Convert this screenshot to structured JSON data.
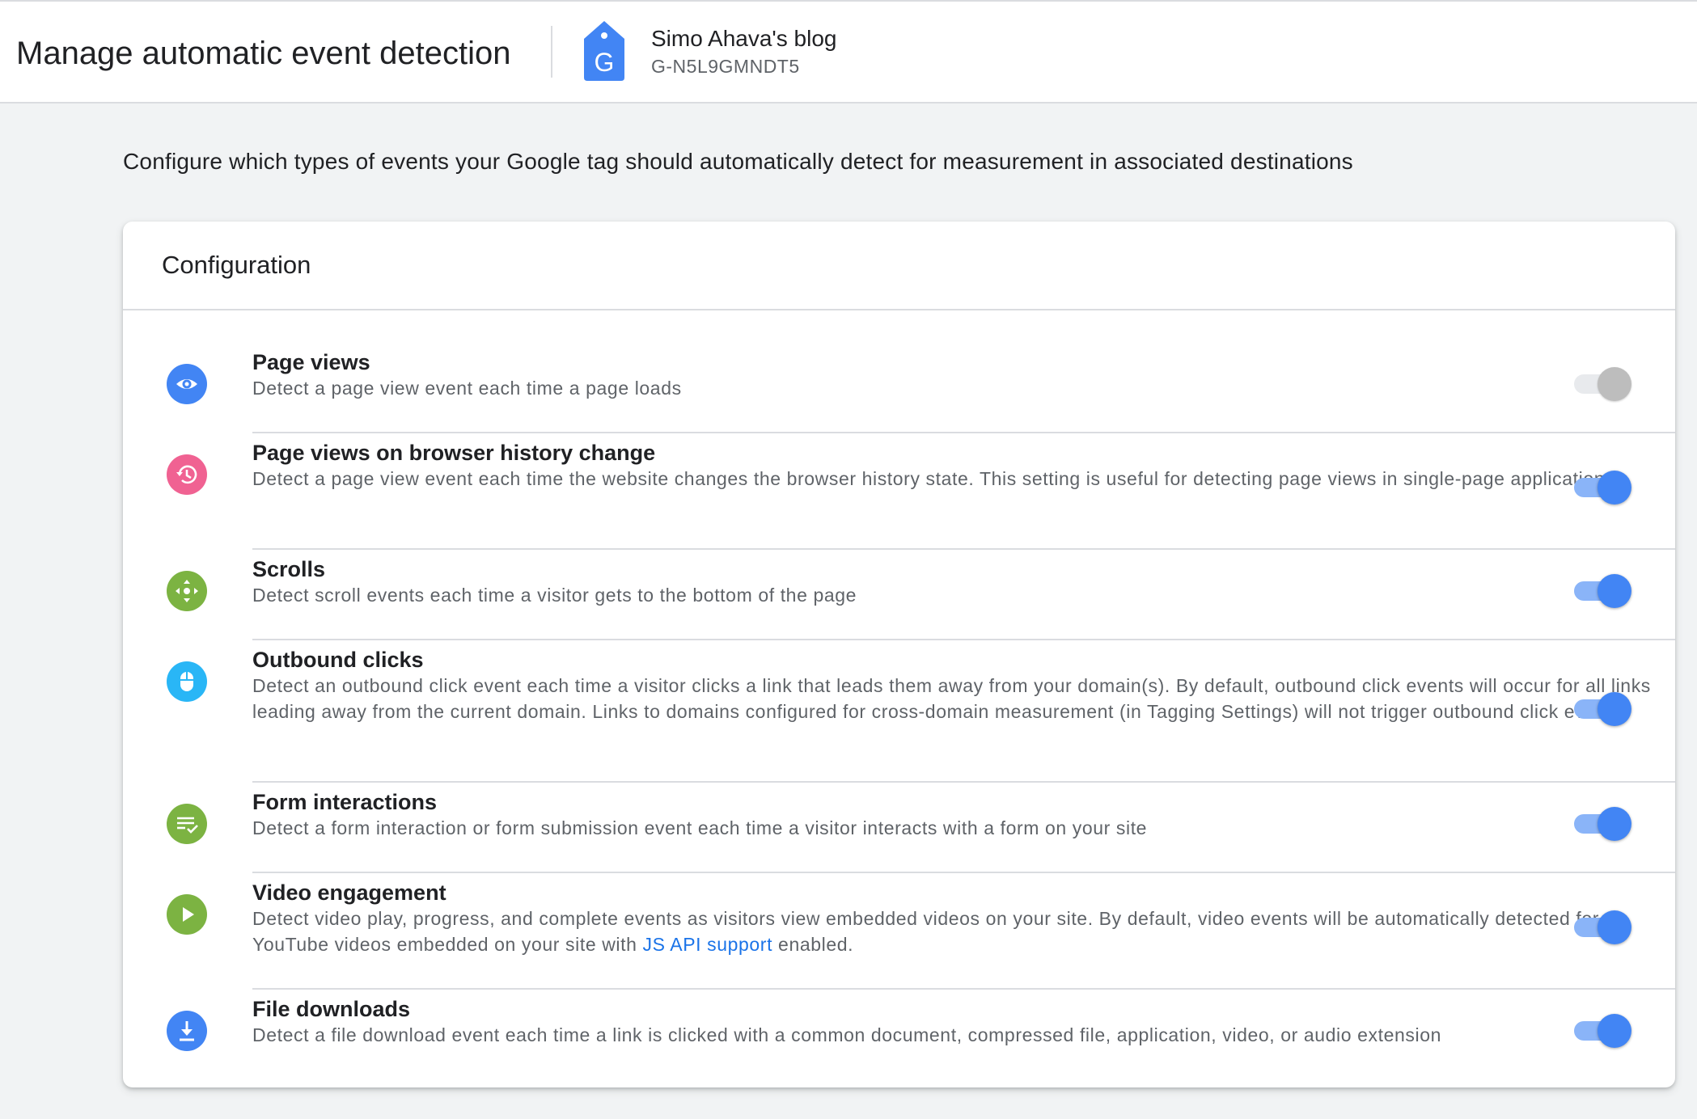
{
  "header": {
    "title": "Manage automatic event detection",
    "property_name": "Simo Ahava's blog",
    "property_id": "G-N5L9GMNDT5",
    "tag_icon": "google-tag-icon",
    "tag_icon_letter": "G"
  },
  "intro": "Configure which types of events your Google tag should automatically detect for measurement in associated destinations",
  "card": {
    "title": "Configuration"
  },
  "settings": [
    {
      "title": "Page views",
      "description": "Detect a page view event each time a page loads",
      "icon": "eye-icon",
      "icon_color": "#4285f4",
      "enabled": true,
      "disabled": true
    },
    {
      "title": "Page views on browser history change",
      "description": "Detect a page view event each time the website changes the browser history state. This setting is useful for detecting page views in single-page applications.",
      "icon": "history-icon",
      "icon_color": "#f06292",
      "enabled": true
    },
    {
      "title": "Scrolls",
      "description": "Detect scroll events each time a visitor gets to the bottom of the page",
      "icon": "move-icon",
      "icon_color": "#7cb342",
      "enabled": true
    },
    {
      "title": "Outbound clicks",
      "description": "Detect an outbound click event each time a visitor clicks a link that leads them away from your domain(s). By default, outbound click events will occur for all links leading away from the current domain. Links to domains configured for cross-domain measurement (in Tagging Settings) will not trigger outbound click events.",
      "icon": "mouse-icon",
      "icon_color": "#29b6f6",
      "enabled": true
    },
    {
      "title": "Form interactions",
      "description": "Detect a form interaction or form submission event each time a visitor interacts with a form on your site",
      "icon": "form-check-icon",
      "icon_color": "#7cb342",
      "enabled": true
    },
    {
      "title": "Video engagement",
      "description_before": "Detect video play, progress, and complete events as visitors view embedded videos on your site. By default, video events will be automatically detected for YouTube videos embedded on your site with ",
      "link_text": "JS API support",
      "description_after": " enabled.",
      "icon": "play-icon",
      "icon_color": "#7cb342",
      "enabled": true
    },
    {
      "title": "File downloads",
      "description": "Detect a file download event each time a link is clicked with a common document, compressed file, application, video, or audio extension",
      "icon": "download-icon",
      "icon_color": "#4285f4",
      "enabled": true
    }
  ],
  "colors": {
    "accent": "#4285f4",
    "link": "#1a73e8",
    "toggle_track_on": "#8ab4f8",
    "toggle_thumb_disabled": "#bdbdbd"
  }
}
